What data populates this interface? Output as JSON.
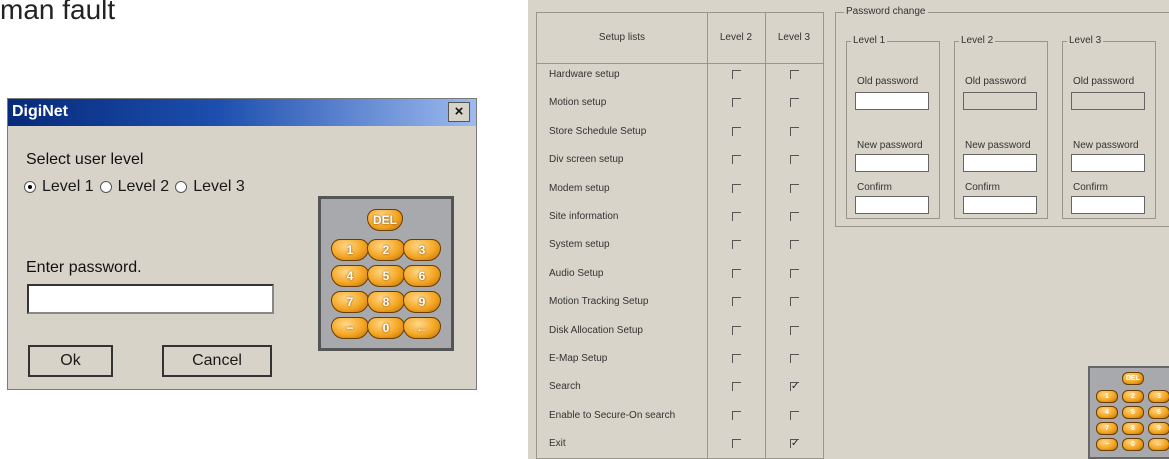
{
  "heading": "man fault",
  "dialog": {
    "title": "DigiNet",
    "close_symbol": "×",
    "select_label": "Select user level",
    "levels": [
      {
        "label": "Level 1",
        "selected": true
      },
      {
        "label": "Level 2",
        "selected": false
      },
      {
        "label": "Level 3",
        "selected": false
      }
    ],
    "password_label": "Enter password.",
    "password_value": "",
    "ok_label": "Ok",
    "cancel_label": "Cancel",
    "keypad": {
      "del": "DEL",
      "keys": [
        "1",
        "2",
        "3",
        "4",
        "5",
        "6",
        "7",
        "8",
        "9",
        "−",
        "0",
        "←"
      ]
    }
  },
  "setup": {
    "columns": [
      "Setup lists",
      "Level 2",
      "Level 3"
    ],
    "rows": [
      {
        "label": "Hardware setup",
        "level2": false,
        "level3": false
      },
      {
        "label": "Motion setup",
        "level2": false,
        "level3": false
      },
      {
        "label": "Store Schedule Setup",
        "level2": false,
        "level3": false
      },
      {
        "label": "Div screen setup",
        "level2": false,
        "level3": false
      },
      {
        "label": "Modem setup",
        "level2": false,
        "level3": false
      },
      {
        "label": "Site information",
        "level2": false,
        "level3": false
      },
      {
        "label": "System setup",
        "level2": false,
        "level3": false
      },
      {
        "label": "Audio Setup",
        "level2": false,
        "level3": false
      },
      {
        "label": "Motion Tracking Setup",
        "level2": false,
        "level3": false
      },
      {
        "label": "Disk Allocation Setup",
        "level2": false,
        "level3": false
      },
      {
        "label": "E-Map Setup",
        "level2": false,
        "level3": false
      },
      {
        "label": "Search",
        "level2": false,
        "level3": true
      },
      {
        "label": "Enable to Secure-On search",
        "level2": false,
        "level3": false
      },
      {
        "label": "Exit",
        "level2": false,
        "level3": true
      }
    ],
    "checkmark": "✓",
    "password_change": {
      "title": "Password change",
      "levels": [
        {
          "title": "Level 1",
          "old_label": "Old password",
          "old_enabled": true,
          "new_label": "New password",
          "confirm_label": "Confirm"
        },
        {
          "title": "Level 2",
          "old_label": "Old password",
          "old_enabled": false,
          "new_label": "New password",
          "confirm_label": "Confirm"
        },
        {
          "title": "Level 3",
          "old_label": "Old password",
          "old_enabled": false,
          "new_label": "New password",
          "confirm_label": "Confirm"
        }
      ]
    }
  },
  "colors": {
    "titlebar_start": "#062a7a",
    "titlebar_end": "#9dbaf0",
    "dialog_bg": "#d8d3c8",
    "key_orange": "#f4a623",
    "keypad_bg": "#a7a9ad"
  },
  "icons": [
    "close-icon",
    "radio-icon",
    "checkbox-icon"
  ]
}
